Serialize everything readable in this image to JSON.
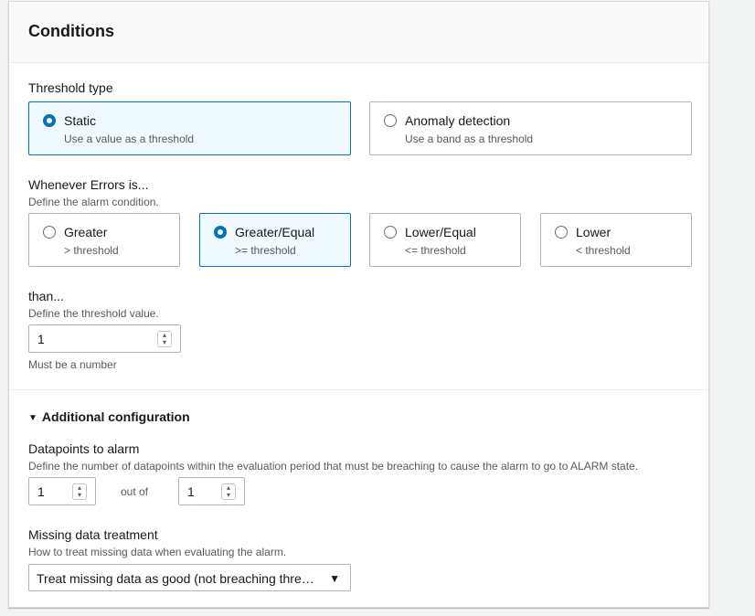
{
  "header": {
    "title": "Conditions"
  },
  "threshold_type": {
    "label": "Threshold type",
    "options": [
      {
        "label": "Static",
        "description": "Use a value as a threshold",
        "selected": true
      },
      {
        "label": "Anomaly detection",
        "description": "Use a band as a threshold",
        "selected": false
      }
    ]
  },
  "condition": {
    "label": "Whenever Errors is...",
    "description": "Define the alarm condition.",
    "options": [
      {
        "label": "Greater",
        "description": "> threshold",
        "selected": false
      },
      {
        "label": "Greater/Equal",
        "description": ">= threshold",
        "selected": true
      },
      {
        "label": "Lower/Equal",
        "description": "<= threshold",
        "selected": false
      },
      {
        "label": "Lower",
        "description": "< threshold",
        "selected": false
      }
    ]
  },
  "threshold": {
    "label": "than...",
    "description": "Define the threshold value.",
    "value": "1",
    "constraint": "Must be a number"
  },
  "additional": {
    "toggle_label": "Additional configuration",
    "datapoints": {
      "label": "Datapoints to alarm",
      "description": "Define the number of datapoints within the evaluation period that must be breaching to cause the alarm to go to ALARM state.",
      "value": "1",
      "out_of_label": "out of",
      "out_of_value": "1"
    },
    "missing_data": {
      "label": "Missing data treatment",
      "description": "How to treat missing data when evaluating the alarm.",
      "selected": "Treat missing data as good (not breaching thre…"
    }
  },
  "colors": {
    "accent": "#0073bb",
    "selected_bg": "#f1faff",
    "border": "#aab7b8"
  }
}
